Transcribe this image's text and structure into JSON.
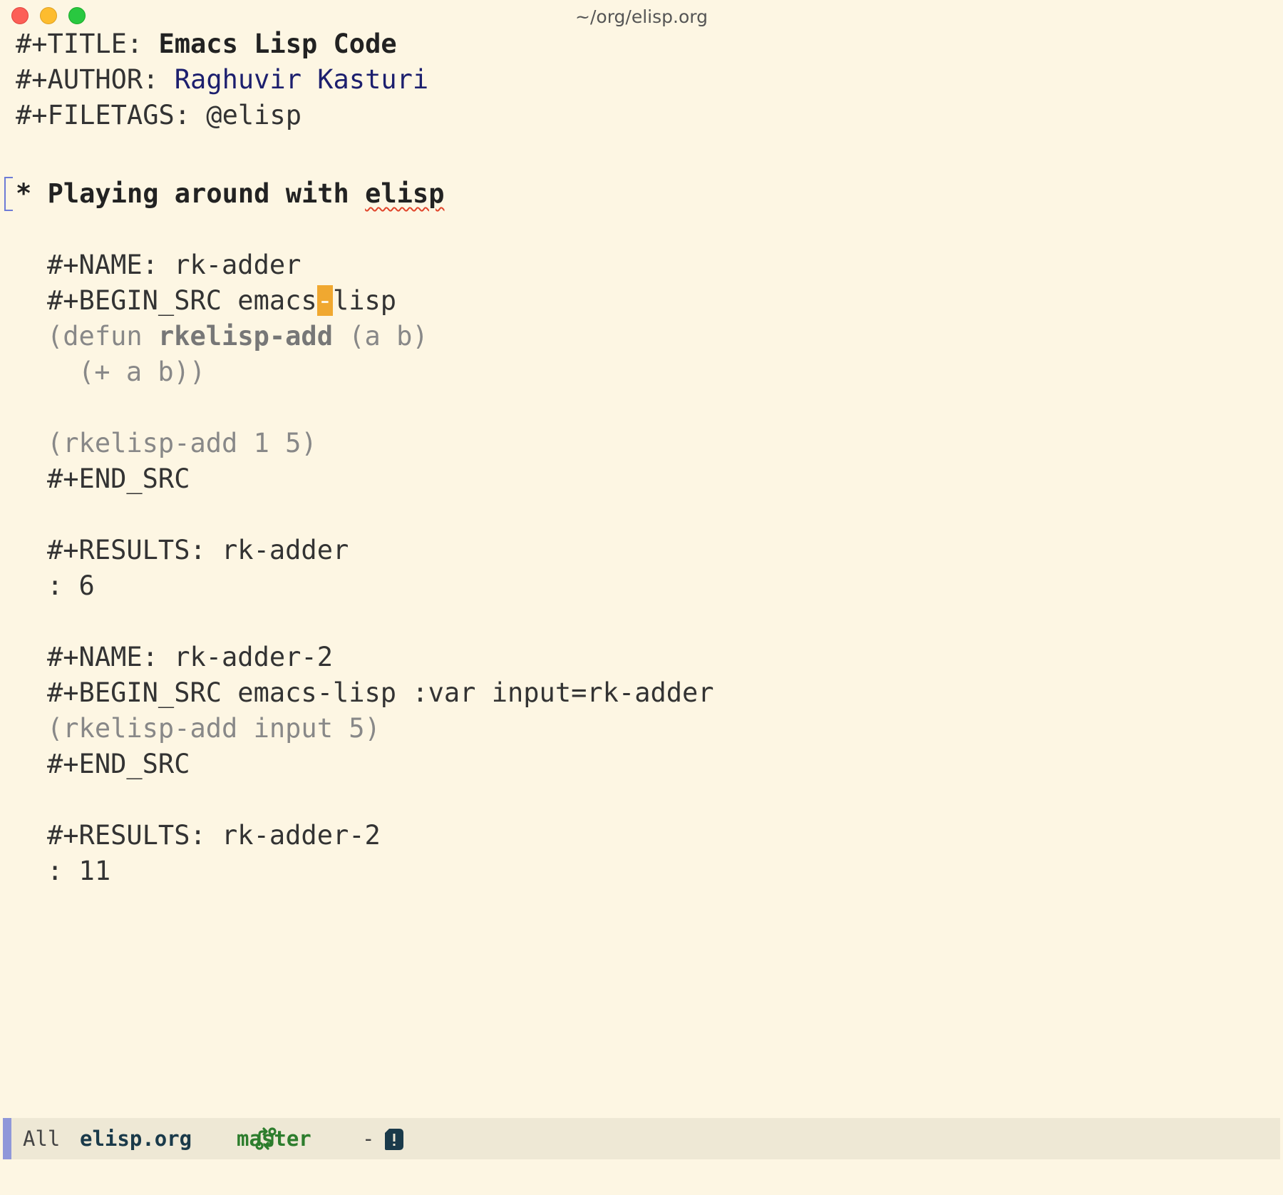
{
  "window": {
    "title": "~/org/elisp.org"
  },
  "buffer": {
    "title_kw": "#+TITLE: ",
    "title_val": "Emacs Lisp Code",
    "author_kw": "#+AUTHOR: ",
    "author_val": "Raghuvir Kasturi",
    "filetags": "#+FILETAGS: @elisp",
    "heading_star": "* ",
    "heading_text": "Playing around with ",
    "heading_word": "elisp",
    "block1": {
      "name": "#+NAME: rk-adder",
      "begin_pre": "#+BEGIN_SRC emacs",
      "begin_cursor": "-",
      "begin_post": "lisp",
      "code1_pre": "(defun ",
      "code1_fn": "rkelisp-add",
      "code1_post": " (a b)",
      "code2": "(+ a b))",
      "code3": "(rkelisp-add 1 5)",
      "end": "#+END_SRC",
      "results": "#+RESULTS: rk-adder",
      "result_val": ": 6"
    },
    "block2": {
      "name": "#+NAME: rk-adder-2",
      "begin": "#+BEGIN_SRC emacs-lisp :var input=rk-adder",
      "code1": "(rkelisp-add input 5)",
      "end": "#+END_SRC",
      "results": "#+RESULTS: rk-adder-2",
      "result_val": ": 11"
    }
  },
  "modeline": {
    "position": "All",
    "file": "elisp.org",
    "branch_icon": "git-branch-icon",
    "branch": "master",
    "flag_icon": "alert-file-icon",
    "flag": "-"
  },
  "colors": {
    "background": "#fdf6e3",
    "modeline_bg": "#eee8d5",
    "cursor": "#f0a830",
    "author": "#1c1f6e",
    "branch": "#2d7d2d"
  }
}
